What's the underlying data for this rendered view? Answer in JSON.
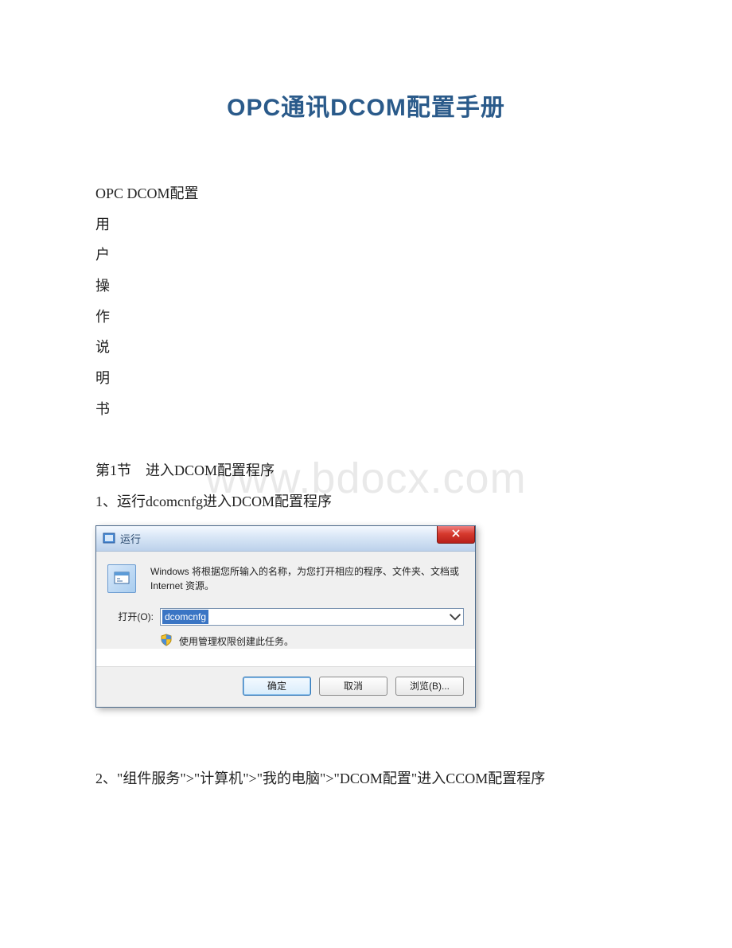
{
  "document": {
    "title": "OPC通讯DCOM配置手册",
    "body_lines": [
      "OPC DCOM配置",
      "用",
      "户",
      "操",
      "作",
      "说",
      "明",
      "书"
    ],
    "section1_heading": "第1节　进入DCOM配置程序",
    "step1": "1、运行dcomcnfg进入DCOM配置程序",
    "step2": "2、\"组件服务\">\"计算机\">\"我的电脑\">\"DCOM配置\"进入CCOM配置程序"
  },
  "watermark": "www.bdocx.com",
  "run_dialog": {
    "title": "运行",
    "description": "Windows 将根据您所输入的名称，为您打开相应的程序、文件夹、文档或 Internet 资源。",
    "open_label": "打开(O):",
    "open_value": "dcomcnfg",
    "admin_note": "使用管理权限创建此任务。",
    "ok_label": "确定",
    "cancel_label": "取消",
    "browse_label": "浏览(B)..."
  }
}
